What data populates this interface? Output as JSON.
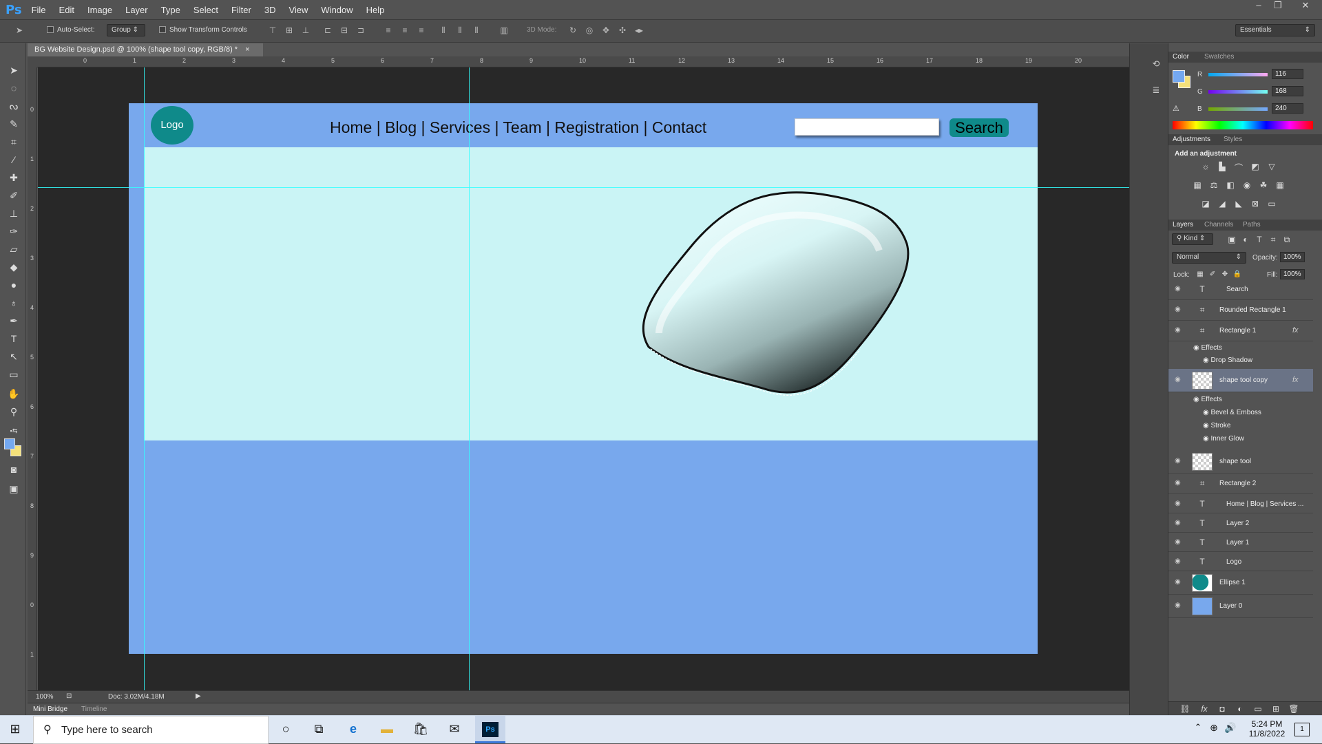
{
  "app": {
    "logo_text": "Ps"
  },
  "menu": [
    "File",
    "Edit",
    "Image",
    "Layer",
    "Type",
    "Select",
    "Filter",
    "3D",
    "View",
    "Window",
    "Help"
  ],
  "options": {
    "auto_select_label": "Auto-Select:",
    "auto_select_value": "Group",
    "transform_label": "Show Transform Controls",
    "mode3d_label": "3D Mode:",
    "workspace": "Essentials"
  },
  "document": {
    "tab_title": "BG Website Design.psd @ 100% (shape tool  copy, RGB/8) *",
    "close": "×"
  },
  "ruler": {
    "h_labels": [
      "1",
      "0",
      "1",
      "2",
      "3",
      "4",
      "5",
      "6",
      "7",
      "8",
      "9",
      "10",
      "11",
      "12",
      "13",
      "14",
      "15",
      "16",
      "17",
      "18",
      "19",
      "20"
    ],
    "v_labels": [
      "0",
      "1",
      "2",
      "3",
      "4",
      "5",
      "6",
      "7",
      "8",
      "9",
      "0",
      "1"
    ]
  },
  "design": {
    "logo": "Logo",
    "nav": "Home | Blog | Services | Team | Registration | Contact",
    "search_button": "Search",
    "colors": {
      "page_bg": "#78a8ed",
      "hero_bg": "#caf4f5",
      "teal": "#0f8a8a",
      "guide": "#33ffff"
    }
  },
  "status": {
    "zoom": "100%",
    "doc_info": "Doc: 3.02M/4.18M"
  },
  "bottom_tabs": [
    "Mini Bridge",
    "Timeline"
  ],
  "color_panel": {
    "tabs": [
      "Color",
      "Swatches"
    ],
    "r_label": "R",
    "g_label": "G",
    "b_label": "B",
    "r": "116",
    "g": "168",
    "b": "240",
    "foreground": "#74a8f0",
    "background": "#f5e17a"
  },
  "adjustments": {
    "tabs": [
      "Adjustments",
      "Styles"
    ],
    "heading": "Add an adjustment"
  },
  "layers_panel": {
    "tabs": [
      "Layers",
      "Channels",
      "Paths"
    ],
    "filter_kind": "Kind",
    "blend_mode": "Normal",
    "opacity_label": "Opacity:",
    "opacity": "100%",
    "lock_label": "Lock:",
    "fill_label": "Fill:",
    "fill": "100%",
    "layers": [
      {
        "name": "Search",
        "icon": "text-icon"
      },
      {
        "name": "Rounded Rectangle 1",
        "icon": "shape-icon"
      },
      {
        "name": "Rectangle 1",
        "icon": "shape-icon",
        "fx": "fx"
      },
      {
        "name": "shape tool  copy",
        "icon": "image-thumb",
        "fx": "fx",
        "selected": true
      },
      {
        "name": "shape tool",
        "icon": "image-thumb"
      },
      {
        "name": "Rectangle 2",
        "icon": "shape-icon"
      },
      {
        "name": "Home | Blog | Services ...",
        "icon": "text-icon"
      },
      {
        "name": "Layer 2",
        "icon": "text-icon"
      },
      {
        "name": "Layer 1",
        "icon": "text-icon"
      },
      {
        "name": "Logo",
        "icon": "text-icon"
      },
      {
        "name": "Ellipse 1",
        "icon": "ellipse-thumb"
      },
      {
        "name": "Layer 0",
        "icon": "fill-thumb"
      }
    ],
    "effects": {
      "rect1": [
        "Effects",
        "Drop Shadow"
      ],
      "shape_copy": [
        "Effects",
        "Bevel & Emboss",
        "Stroke",
        "Inner Glow"
      ]
    }
  },
  "taskbar": {
    "search_placeholder": "Type here to search",
    "time": "5:24 PM",
    "date": "11/8/2022",
    "notification_count": "1"
  }
}
